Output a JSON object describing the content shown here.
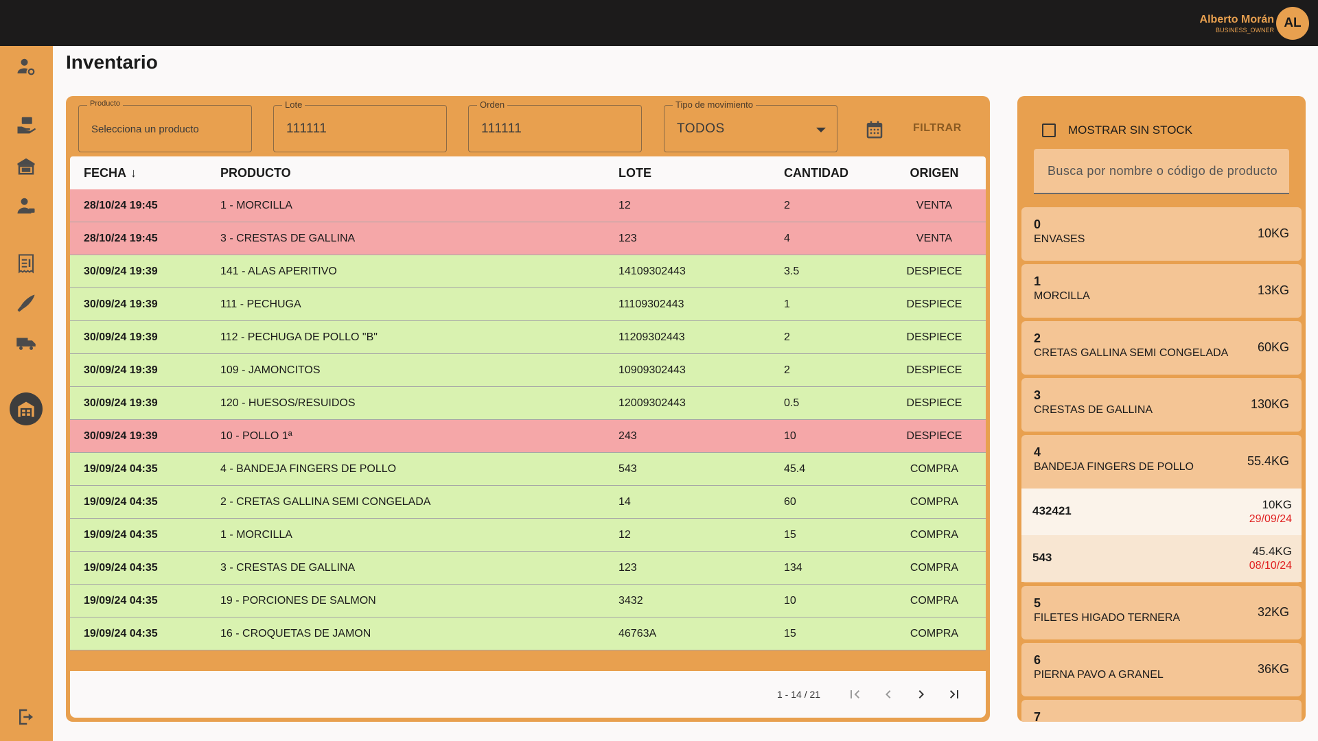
{
  "header": {
    "user_name": "Alberto Morán",
    "user_role": "BUSINESS_OWNER",
    "avatar_initials": "AL"
  },
  "page": {
    "title": "Inventario"
  },
  "filters": {
    "producto": {
      "label": "Producto",
      "placeholder": "Selecciona un producto"
    },
    "lote": {
      "label": "Lote",
      "value": "111111"
    },
    "orden": {
      "label": "Orden",
      "value": "111111"
    },
    "tipo": {
      "label": "Tipo de movimiento",
      "value": "TODOS"
    },
    "filter_label": "FILTRAR"
  },
  "table": {
    "headers": {
      "fecha": "FECHA",
      "producto": "PRODUCTO",
      "lote": "LOTE",
      "cantidad": "CANTIDAD",
      "origen": "ORIGEN"
    },
    "rows": [
      {
        "fecha": "28/10/24 19:45",
        "producto": "1 - MORCILLA",
        "lote": "12",
        "cantidad": "2",
        "origen": "VENTA",
        "status": "red"
      },
      {
        "fecha": "28/10/24 19:45",
        "producto": "3 - CRESTAS DE GALLINA",
        "lote": "123",
        "cantidad": "4",
        "origen": "VENTA",
        "status": "red"
      },
      {
        "fecha": "30/09/24 19:39",
        "producto": "141 - ALAS APERITIVO",
        "lote": "14109302443",
        "cantidad": "3.5",
        "origen": "DESPIECE",
        "status": "green"
      },
      {
        "fecha": "30/09/24 19:39",
        "producto": "111 - PECHUGA",
        "lote": "11109302443",
        "cantidad": "1",
        "origen": "DESPIECE",
        "status": "green"
      },
      {
        "fecha": "30/09/24 19:39",
        "producto": "112 - PECHUGA DE POLLO \"B\"",
        "lote": "11209302443",
        "cantidad": "2",
        "origen": "DESPIECE",
        "status": "green"
      },
      {
        "fecha": "30/09/24 19:39",
        "producto": "109 - JAMONCITOS",
        "lote": "10909302443",
        "cantidad": "2",
        "origen": "DESPIECE",
        "status": "green"
      },
      {
        "fecha": "30/09/24 19:39",
        "producto": "120 - HUESOS/RESUIDOS",
        "lote": "12009302443",
        "cantidad": "0.5",
        "origen": "DESPIECE",
        "status": "green"
      },
      {
        "fecha": "30/09/24 19:39",
        "producto": "10 - POLLO 1ª",
        "lote": "243",
        "cantidad": "10",
        "origen": "DESPIECE",
        "status": "red"
      },
      {
        "fecha": "19/09/24 04:35",
        "producto": "4 - BANDEJA FINGERS DE POLLO",
        "lote": "543",
        "cantidad": "45.4",
        "origen": "COMPRA",
        "status": "green"
      },
      {
        "fecha": "19/09/24 04:35",
        "producto": "2 - CRETAS GALLINA SEMI CONGELADA",
        "lote": "14",
        "cantidad": "60",
        "origen": "COMPRA",
        "status": "green"
      },
      {
        "fecha": "19/09/24 04:35",
        "producto": "1 - MORCILLA",
        "lote": "12",
        "cantidad": "15",
        "origen": "COMPRA",
        "status": "green"
      },
      {
        "fecha": "19/09/24 04:35",
        "producto": "3 - CRESTAS DE GALLINA",
        "lote": "123",
        "cantidad": "134",
        "origen": "COMPRA",
        "status": "green"
      },
      {
        "fecha": "19/09/24 04:35",
        "producto": "19 - PORCIONES DE SALMON",
        "lote": "3432",
        "cantidad": "10",
        "origen": "COMPRA",
        "status": "green"
      },
      {
        "fecha": "19/09/24 04:35",
        "producto": "16 - CROQUETAS DE JAMON",
        "lote": "46763A",
        "cantidad": "15",
        "origen": "COMPRA",
        "status": "green"
      }
    ]
  },
  "pagination": {
    "range": "1 - 14 / 21"
  },
  "stock_panel": {
    "show_no_stock_label": "MOSTRAR SIN STOCK",
    "search_placeholder": "Busca por nombre o código de producto",
    "items": [
      {
        "code": "0",
        "name": "ENVASES",
        "qty": "10KG"
      },
      {
        "code": "1",
        "name": "MORCILLA",
        "qty": "13KG"
      },
      {
        "code": "2",
        "name": "CRETAS GALLINA SEMI CONGELADA",
        "qty": "60KG"
      },
      {
        "code": "3",
        "name": "CRESTAS DE GALLINA",
        "qty": "130KG"
      },
      {
        "code": "4",
        "name": "BANDEJA FINGERS DE POLLO",
        "qty": "55.4KG",
        "lots": [
          {
            "code": "432421",
            "qty": "10KG",
            "date": "29/09/24"
          },
          {
            "code": "543",
            "qty": "45.4KG",
            "date": "08/10/24"
          }
        ]
      },
      {
        "code": "5",
        "name": "FILETES HIGADO TERNERA",
        "qty": "32KG"
      },
      {
        "code": "6",
        "name": "PIERNA PAVO A GRANEL",
        "qty": "36KG"
      },
      {
        "code": "7",
        "name": "",
        "qty": ""
      }
    ]
  },
  "icons": {
    "sidebar": [
      "user-settings-icon",
      "hand-cash-icon",
      "store-icon",
      "employee-icon",
      "receipt-icon",
      "knife-icon",
      "truck-icon",
      "warehouse-icon",
      "logout-icon"
    ]
  }
}
